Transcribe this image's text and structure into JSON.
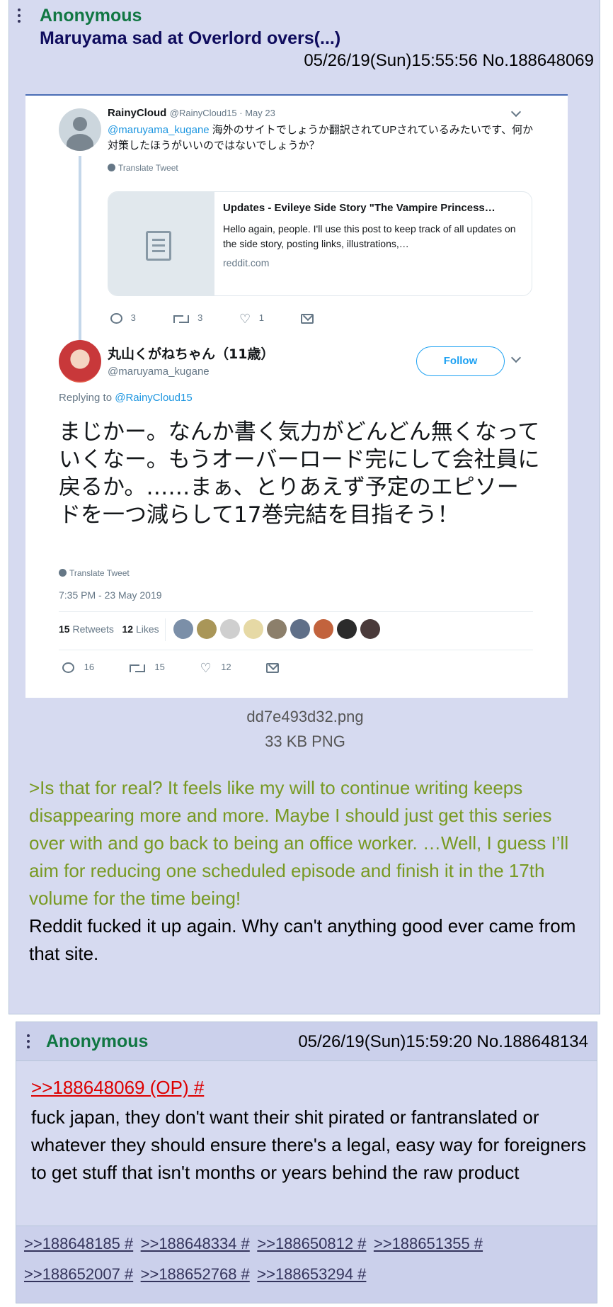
{
  "op": {
    "name": "Anonymous",
    "subject": "Maruyama sad at Overlord overs(...)",
    "datetime": "05/26/19(Sun)15:55:56 No.188648069",
    "file": {
      "filename": "dd7e493d32.png",
      "size": "33 KB PNG"
    },
    "greentext": ">Is that for real? It feels like my will to continue writing keeps disappearing more and more. Maybe I should just get this series over with and go back to being an office worker. …Well, I guess I’ll aim for reducing one scheduled episode and finish it in the 17th volume for the time being!",
    "comment": "Reddit fucked it up again. Why can't anything good ever came from that site."
  },
  "tweet": {
    "parent": {
      "name": "RainyCloud",
      "handle_date": "@RainyCloud15 · May 23",
      "mention": "@maruyama_kugane",
      "text": " 海外のサイトでしょうか翻訳されてUPされているみたいです、何か対策したほうがいいのではないでしょうか？",
      "translate": "Translate Tweet",
      "card_title": "Updates - Evileye Side Story \"The Vampire Princess…",
      "card_desc": "Hello again, people. I'll use this post to keep track of all updates on the side story, posting links, illustrations,…",
      "card_url": "reddit.com",
      "replies": "3",
      "retweets": "3",
      "likes": "1"
    },
    "main": {
      "name": "丸山くがねちゃん（11歳）",
      "handle": "@maruyama_kugane",
      "follow_label": "Follow",
      "replying_prefix": "Replying to ",
      "replying_to": "@RainyCloud15",
      "text": "まじかー。なんか書く気力がどんどん無くなっていくなー。もうオーバーロード完にして会社員に戻るか。……まぁ、とりあえず予定のエピソードを一つ減らして17巻完結を目指そう！",
      "translate": "Translate Tweet",
      "timestamp": "7:35 PM - 23 May 2019",
      "retweets_count": "15",
      "retweets_label": "Retweets",
      "likes_count": "12",
      "likes_label": "Likes",
      "replies": "16",
      "retweets": "15",
      "likes": "12"
    }
  },
  "reply": {
    "name": "Anonymous",
    "datetime": "05/26/19(Sun)15:59:20 No.188648134",
    "quote": ">>188648069 (OP) #",
    "comment": "fuck japan, they don't want their shit pirated or fantranslated or whatever they should ensure there's a legal, easy way for foreigners to get stuff that isn't months or years behind the raw product",
    "backlinks": [
      ">>188648185 #",
      ">>188648334 #",
      ">>188650812 #",
      ">>188651355 #",
      ">>188652007 #",
      ">>188652768 #",
      ">>188653294 #"
    ]
  },
  "colors": {
    "post_bg": "#d6daf0",
    "name": "#117743",
    "subject": "#0f0c5d",
    "greentext": "#789922",
    "quotelink": "#dd0000",
    "tweet_blue": "#1da1f2"
  },
  "icons": [
    "menu-dots-icon",
    "avatar-icon",
    "document-icon",
    "reply-icon",
    "retweet-icon",
    "like-icon",
    "mail-icon",
    "globe-icon",
    "chevron-down-icon"
  ]
}
